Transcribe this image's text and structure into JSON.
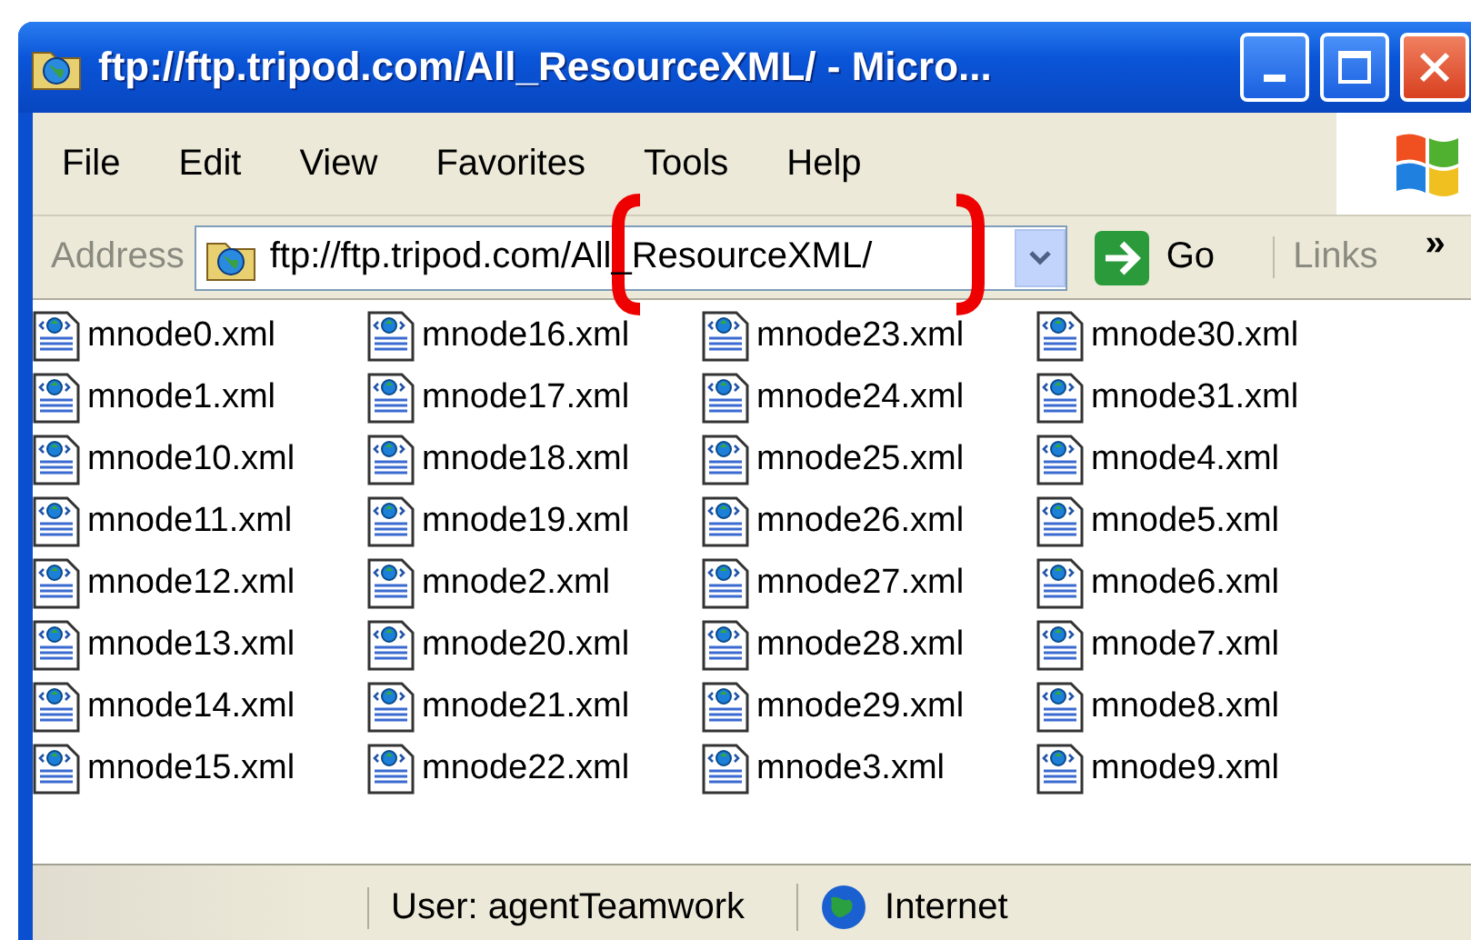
{
  "window": {
    "title": "ftp://ftp.tripod.com/All_ResourceXML/ - Micro..."
  },
  "menu": [
    "File",
    "Edit",
    "View",
    "Favorites",
    "Tools",
    "Help"
  ],
  "address_bar": {
    "label": "Address",
    "value": "ftp://ftp.tripod.com/All_ResourceXML/",
    "go": "Go",
    "links": "Links",
    "more": "»"
  },
  "files": [
    "mnode0.xml",
    "mnode1.xml",
    "mnode10.xml",
    "mnode11.xml",
    "mnode12.xml",
    "mnode13.xml",
    "mnode14.xml",
    "mnode15.xml",
    "mnode16.xml",
    "mnode17.xml",
    "mnode18.xml",
    "mnode19.xml",
    "mnode2.xml",
    "mnode20.xml",
    "mnode21.xml",
    "mnode22.xml",
    "mnode23.xml",
    "mnode24.xml",
    "mnode25.xml",
    "mnode26.xml",
    "mnode27.xml",
    "mnode28.xml",
    "mnode29.xml",
    "mnode3.xml",
    "mnode30.xml",
    "mnode31.xml",
    "mnode4.xml",
    "mnode5.xml",
    "mnode6.xml",
    "mnode7.xml",
    "mnode8.xml",
    "mnode9.xml"
  ],
  "status_bar": {
    "user": "User: agentTeamwork",
    "zone": "Internet"
  }
}
